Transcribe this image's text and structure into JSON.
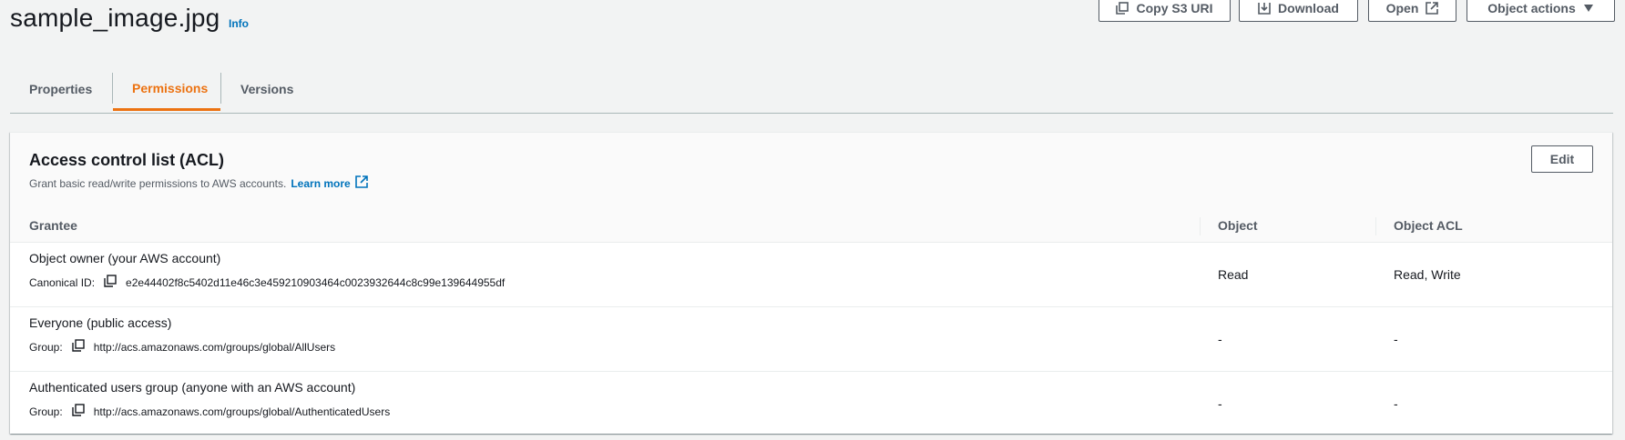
{
  "header": {
    "title": "sample_image.jpg",
    "info_label": "Info",
    "actions": {
      "copy_s3_uri": "Copy S3 URI",
      "download": "Download",
      "open": "Open",
      "object_actions": "Object actions"
    }
  },
  "tabs": [
    {
      "label": "Properties",
      "active": false
    },
    {
      "label": "Permissions",
      "active": true
    },
    {
      "label": "Versions",
      "active": false
    }
  ],
  "acl": {
    "title": "Access control list (ACL)",
    "description": "Grant basic read/write permissions to AWS accounts.",
    "learn_more": "Learn more",
    "edit_label": "Edit",
    "columns": [
      "Grantee",
      "Object",
      "Object ACL"
    ],
    "rows": [
      {
        "grantee": "Object owner (your AWS account)",
        "id_label": "Canonical ID:",
        "id_value": "e2e44402f8c5402d11e46c3e459210903464c0023932644c8c99e139644955df",
        "object": "Read",
        "object_acl": "Read, Write"
      },
      {
        "grantee": "Everyone (public access)",
        "id_label": "Group:",
        "id_value": "http://acs.amazonaws.com/groups/global/AllUsers",
        "object": "-",
        "object_acl": "-"
      },
      {
        "grantee": "Authenticated users group (anyone with an AWS account)",
        "id_label": "Group:",
        "id_value": "http://acs.amazonaws.com/groups/global/AuthenticatedUsers",
        "object": "-",
        "object_acl": "-"
      }
    ]
  },
  "colors": {
    "accent": "#ec7211",
    "link": "#0073bb",
    "text": "#16191f",
    "muted": "#545b64"
  }
}
